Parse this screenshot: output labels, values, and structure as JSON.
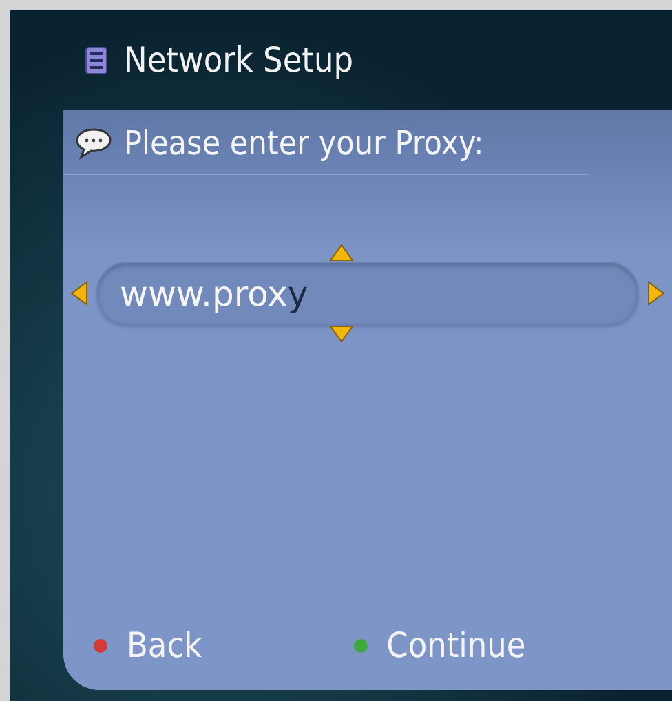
{
  "window": {
    "title": "Network Setup"
  },
  "prompt": "Please enter your Proxy:",
  "input": {
    "value": "www.prox",
    "cursor_char": "y"
  },
  "buttons": [
    {
      "label": "Back",
      "color": "#d43a3a"
    },
    {
      "label": "Continue",
      "color": "#3fa83f"
    }
  ]
}
